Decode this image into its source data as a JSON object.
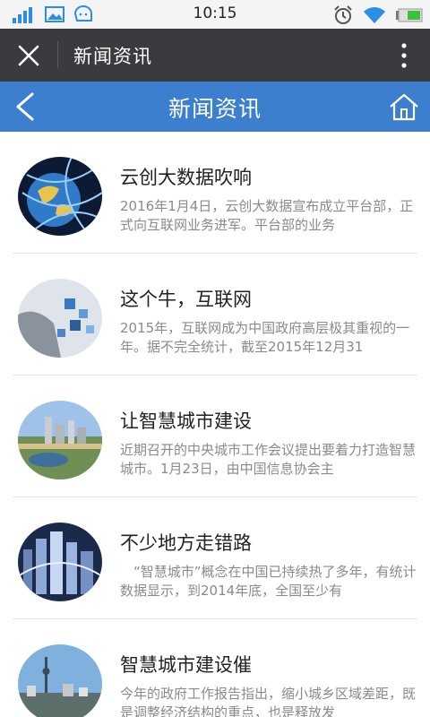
{
  "status_bar": {
    "time": "10:15"
  },
  "app_bar": {
    "title": "新闻资讯"
  },
  "blue_bar": {
    "title": "新闻资讯"
  },
  "news": [
    {
      "title": "云创大数据吹响",
      "summary": "2016年1月4日，云创大数据宣布成立平台部，正式向互联网业务进军。平台部的业务"
    },
    {
      "title": "这个牛，互联网",
      "summary": "2015年，互联网成为中国政府高层极其重视的一年。据不完全统计，截至2015年12月31"
    },
    {
      "title": "让智慧城市建设",
      "summary": "近期召开的中央城市工作会议提出要着力打造智慧城市。1月23日，由中国信息协会主"
    },
    {
      "title": "不少地方走错路",
      "summary": "　“智慧城市”概念在中国已持续热了多年，有统计数据显示，到2014年底，全国至少有"
    },
    {
      "title": "智慧城市建设催",
      "summary": "今年的政府工作报告指出，缩小城乡区域差距，既是调整经济结构的重点，也是释放发"
    }
  ]
}
